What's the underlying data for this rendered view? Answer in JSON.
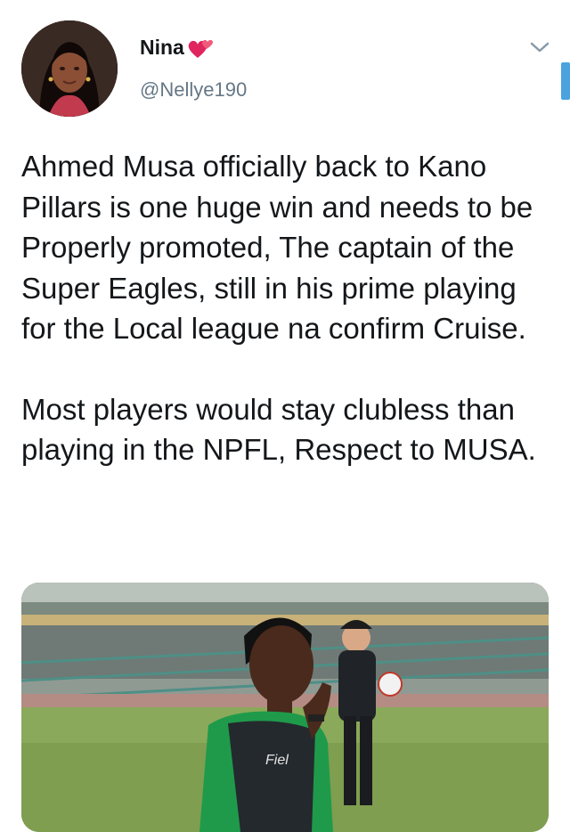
{
  "user": {
    "display_name": "Nina",
    "handle": "@Nellye190",
    "name_emoji_icon": "two-hearts-icon"
  },
  "header": {
    "menu_icon": "chevron-down-icon"
  },
  "tweet": {
    "paragraphs": [
      "Ahmed Musa officially back to Kano Pillars is one huge win and needs to be Properly promoted, The captain of the Super Eagles, still in his prime playing for the Local league na confirm Cruise.",
      "Most players would stay clubless than playing in the NPFL, Respect to MUSA."
    ]
  },
  "media": {
    "photo_jersey_text": "Fiel"
  },
  "colors": {
    "text": "#14171a",
    "secondary": "#657786",
    "accent": "#1da1f2",
    "heart": "#e0245e"
  }
}
